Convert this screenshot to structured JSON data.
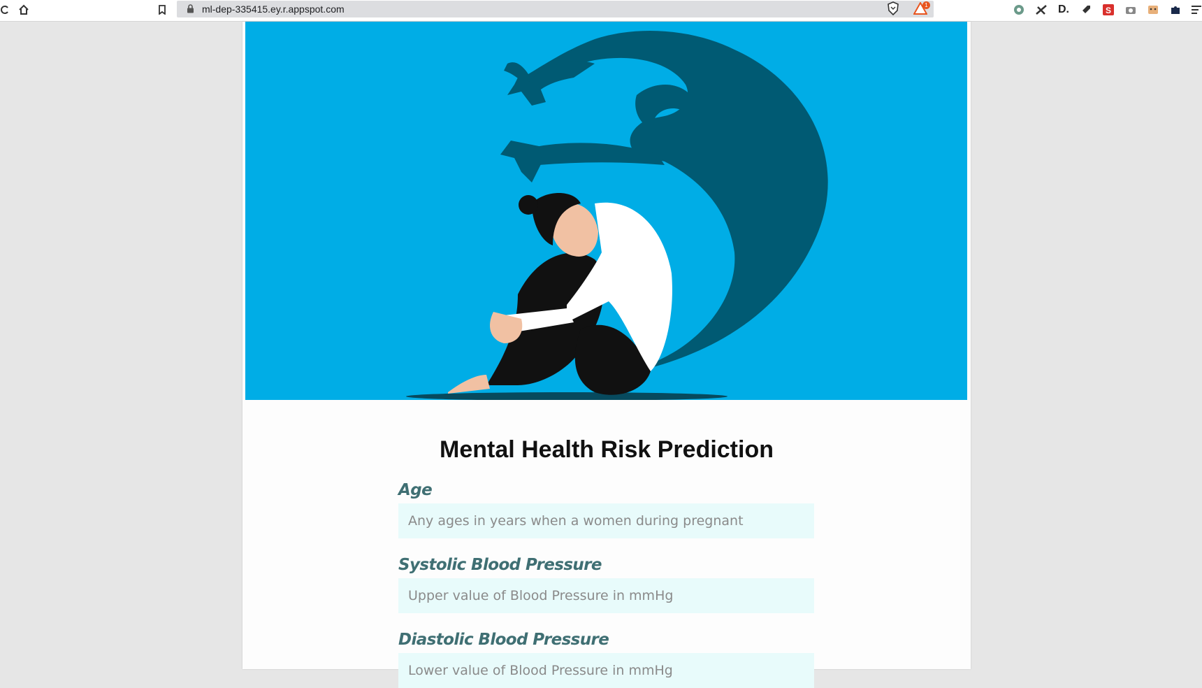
{
  "browser": {
    "url": "ml-dep-335415.ey.r.appspot.com",
    "bat_badge": "1"
  },
  "page": {
    "title": "Mental Health Risk Prediction",
    "fields": [
      {
        "label": "Age",
        "placeholder": "Any ages in years when a women during pregnant"
      },
      {
        "label": "Systolic Blood Pressure",
        "placeholder": "Upper value of Blood Pressure in mmHg"
      },
      {
        "label": "Diastolic Blood Pressure",
        "placeholder": "Lower value of Blood Pressure in mmHg"
      }
    ]
  },
  "colors": {
    "hero_background": "#00ade6",
    "shadow_monster": "#005a73",
    "label_color": "#3f6f73",
    "input_background": "#e8fbfb"
  }
}
